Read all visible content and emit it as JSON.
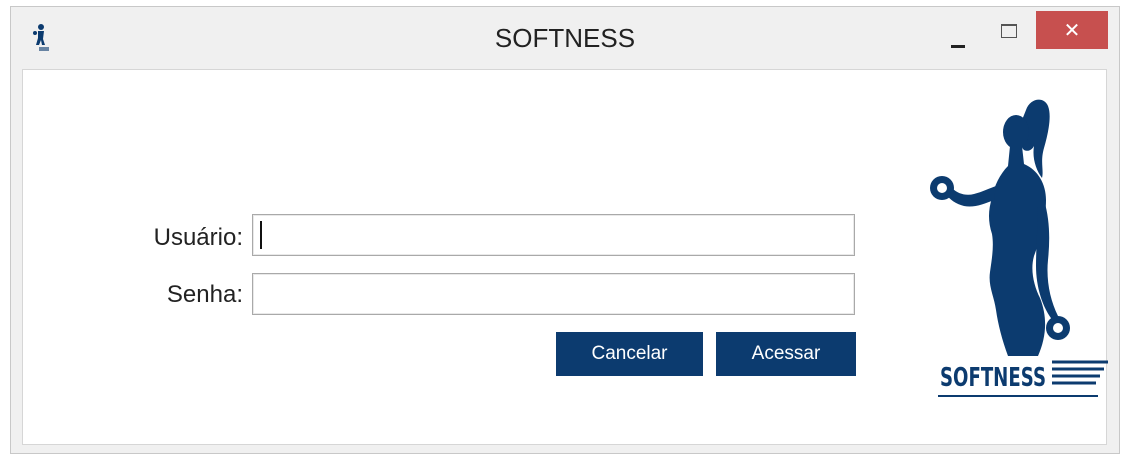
{
  "window": {
    "title": "SOFTNESS",
    "close_glyph": "✕"
  },
  "form": {
    "user_label": "Usuário:",
    "user_value": "",
    "password_label": "Senha:",
    "password_value": ""
  },
  "buttons": {
    "cancel": "Cancelar",
    "access": "Acessar"
  },
  "logo": {
    "text": "SOFTNESS",
    "icon": "fitness-woman-dumbbell-logo"
  },
  "colors": {
    "brand": "#0c3b6f",
    "close_button": "#c7504f"
  }
}
